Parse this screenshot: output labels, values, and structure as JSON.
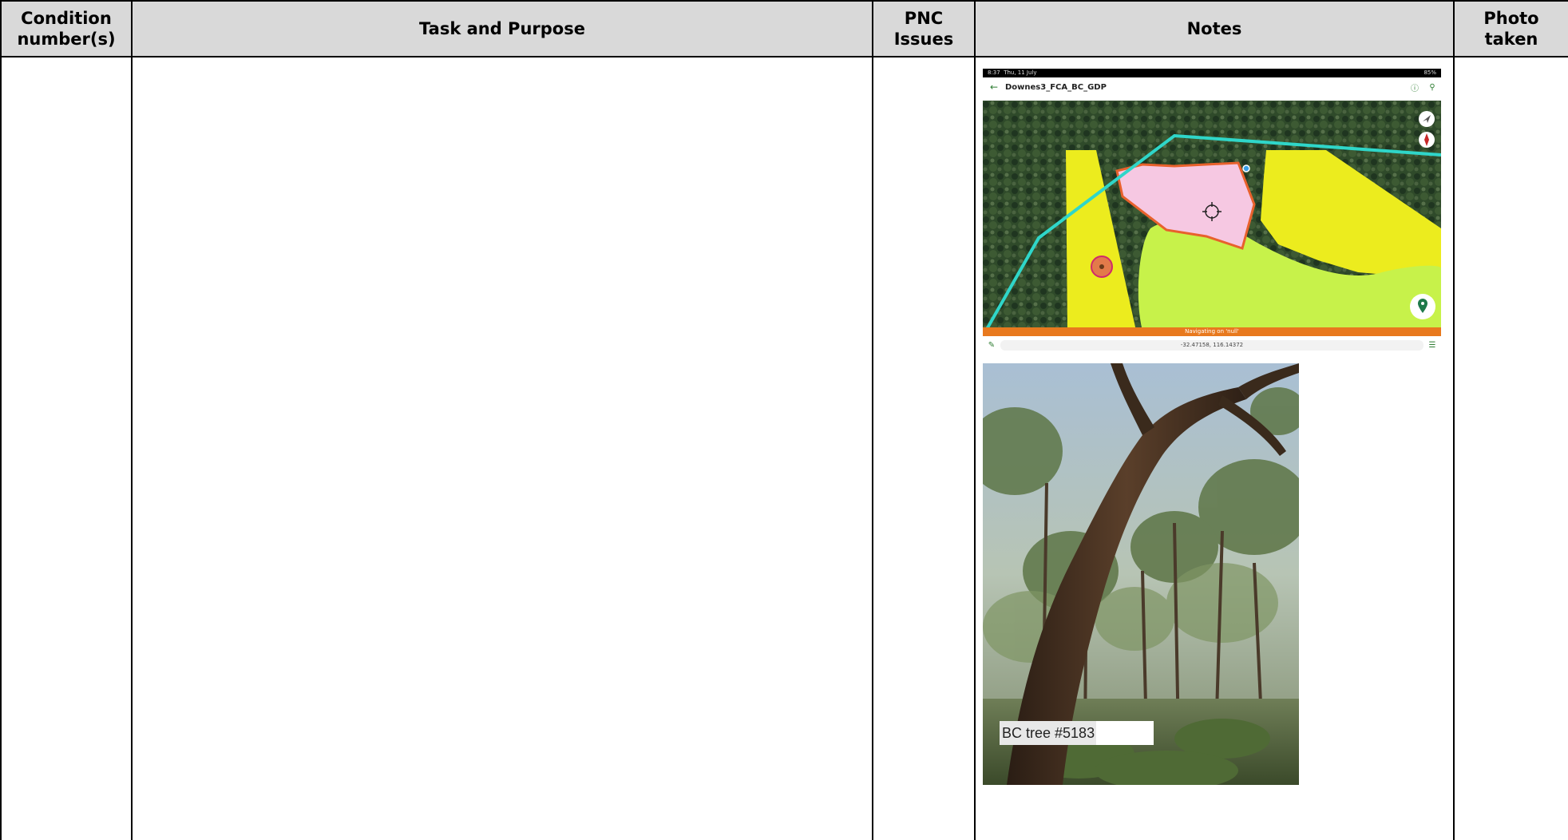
{
  "table": {
    "headers": {
      "condition": "Condition\nnumber(s)",
      "task": "Task and Purpose",
      "pnc": "PNC\nIssues",
      "notes": "Notes",
      "photo": "Photo\ntaken"
    }
  },
  "notes": {
    "map_screenshot": {
      "status_time": "8:37",
      "status_date": "Thu, 11 July",
      "status_right": "85%",
      "title": "Downes3_FCA_BC_GDP",
      "navigating_text": "Navigating on 'null'",
      "coordinates": "-32.47158, 116.14372",
      "icons": [
        "back-arrow-icon",
        "info-icon",
        "search-icon",
        "navigate-icon",
        "compass-icon",
        "location-pin-icon",
        "pencil-icon",
        "layers-icon"
      ],
      "colors": {
        "track_line": "#2fd6c9",
        "yellow_zone": "#ecec1e",
        "light_green_zone": "#c7f24a",
        "pink_zone": "#f6c8e2",
        "pink_outline": "#e8612c",
        "nav_bar": "#e8791e"
      }
    },
    "tree_photo": {
      "caption": "BC tree #5183"
    }
  }
}
